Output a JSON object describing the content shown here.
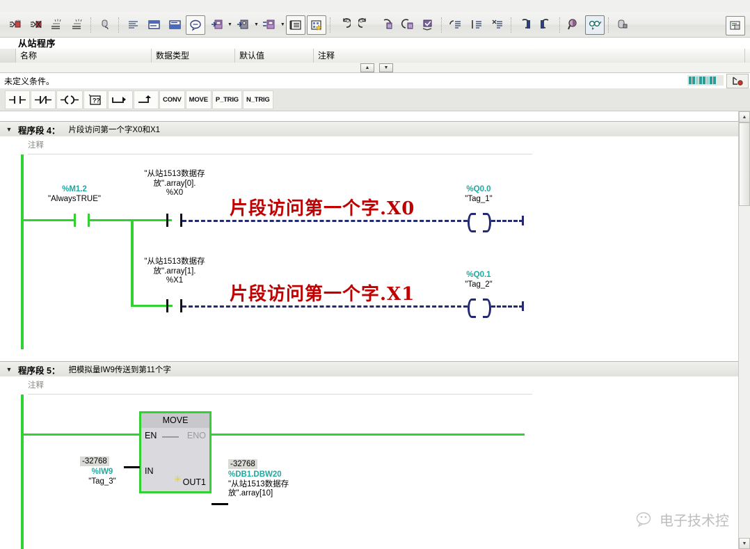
{
  "toolbar": {
    "icons": [
      {
        "name": "open-block-icon"
      },
      {
        "name": "close-block-icon"
      },
      {
        "name": "insert-network-icon"
      },
      {
        "name": "delete-network-icon"
      },
      {
        "name": "absolute-symbolic-icon"
      },
      {
        "name": "show-all-icon"
      },
      {
        "name": "network-comment-icon"
      },
      {
        "name": "network-title-icon"
      },
      {
        "name": "comment-bubble-icon"
      },
      {
        "name": "download-to-device-icon"
      },
      {
        "name": "upload-from-device-icon"
      },
      {
        "name": "compare-icon"
      },
      {
        "name": "symbol-table-icon"
      },
      {
        "name": "favorites-icon"
      },
      {
        "name": "undo-icon"
      },
      {
        "name": "redo-icon"
      },
      {
        "name": "goto-previous-icon"
      },
      {
        "name": "goto-next-icon"
      },
      {
        "name": "reorganize-icon"
      },
      {
        "name": "align-left-icon"
      },
      {
        "name": "align-center-icon"
      },
      {
        "name": "align-right-icon"
      },
      {
        "name": "prev-error-icon"
      },
      {
        "name": "next-error-icon"
      },
      {
        "name": "zoom-icon"
      },
      {
        "name": "monitoring-glasses-icon"
      },
      {
        "name": "memory-reserve-icon"
      },
      {
        "name": "block-properties-icon"
      }
    ]
  },
  "title": {
    "block_name": "从站程序"
  },
  "interface_table": {
    "columns": [
      "名称",
      "数据类型",
      "默认值",
      "注释"
    ]
  },
  "condition_bar": {
    "text": "未定义条件。"
  },
  "instruction_palette": {
    "buttons": [
      {
        "name": "no-contact-button",
        "label": "⊣ ⊢",
        "kind": "glyph"
      },
      {
        "name": "nc-contact-button",
        "label": "⊣/⊢",
        "kind": "glyph"
      },
      {
        "name": "coil-button",
        "label": "⊣( )⊢",
        "kind": "glyph"
      },
      {
        "name": "empty-box-button",
        "label": "??",
        "kind": "glyph"
      },
      {
        "name": "open-branch-button",
        "label": "↦",
        "kind": "glyph"
      },
      {
        "name": "close-branch-button",
        "label": "⌐",
        "kind": "glyph"
      },
      {
        "name": "conv-button",
        "label": "CONV",
        "kind": "text"
      },
      {
        "name": "move-button",
        "label": "MOVE",
        "kind": "text"
      },
      {
        "name": "ptrig-button",
        "label": "P_TRIG",
        "kind": "text"
      },
      {
        "name": "ntrig-button",
        "label": "N_TRIG",
        "kind": "text"
      }
    ]
  },
  "networks": [
    {
      "id": "network-4",
      "title": "程序段 4：",
      "description": "片段访问第一个字X0和X1",
      "comment_placeholder": "注释",
      "rungs": [
        {
          "contacts": [
            {
              "address": "%M1.2",
              "tag": "\"AlwaysTRUE\"",
              "state": "true"
            },
            {
              "path1": "\"从站1513数据存",
              "path2": "放\".array[0].",
              "path3": "%X0",
              "state": "unknown"
            }
          ],
          "coil": {
            "address": "%Q0.0",
            "tag": "\"Tag_1\""
          },
          "annotation": "片段访问第一个字.X0"
        },
        {
          "contacts": [
            {
              "path1": "\"从站1513数据存",
              "path2": "放\".array[1].",
              "path3": "%X1",
              "state": "unknown"
            }
          ],
          "coil": {
            "address": "%Q0.1",
            "tag": "\"Tag_2\""
          },
          "annotation": "片段访问第一个字.X1"
        }
      ]
    },
    {
      "id": "network-5",
      "title": "程序段 5：",
      "description": "把模拟量IW9传送到第11个字",
      "comment_placeholder": "注释",
      "move_block": {
        "name": "MOVE",
        "en_label": "EN",
        "eno_label": "ENO",
        "in_label": "IN",
        "out_label": "OUT1",
        "input": {
          "value": "-32768",
          "address": "%IW9",
          "tag": "\"Tag_3\""
        },
        "output": {
          "value": "-32768",
          "address": "%DB1.DBW20",
          "path1": "\"从站1513数据存",
          "path2": "放\".array[10]"
        }
      }
    }
  ],
  "watermark": {
    "text": "电子技术控",
    "icon": "wechat-icon"
  },
  "colors": {
    "rail_green": "#31d131",
    "address_teal": "#1fa8a0",
    "coil_navy": "#232a72",
    "annotation_red": "#c00000"
  }
}
